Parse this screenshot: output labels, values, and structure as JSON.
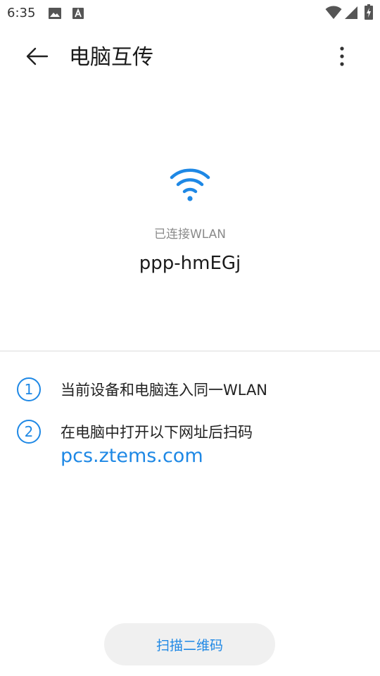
{
  "status_bar": {
    "time": "6:35",
    "icons": [
      "image-icon",
      "text-a-icon",
      "wifi-icon",
      "cell-signal-icon",
      "battery-charging-icon"
    ]
  },
  "app_bar": {
    "title": "电脑互传",
    "back_icon": "arrow-back-icon",
    "menu_icon": "more-vert-icon"
  },
  "wifi": {
    "icon": "wifi-icon",
    "status": "已连接WLAN",
    "ssid": "ppp-hmEGj"
  },
  "steps": [
    {
      "number": "1",
      "text": "当前设备和电脑连入同一WLAN"
    },
    {
      "number": "2",
      "text": "在电脑中打开以下网址后扫码",
      "link": "pcs.ztems.com"
    }
  ],
  "actions": {
    "scan_label": "扫描二维码"
  },
  "colors": {
    "accent": "#1e88e5",
    "divider": "#dcdcdc",
    "button_bg": "#f0f0f0"
  }
}
